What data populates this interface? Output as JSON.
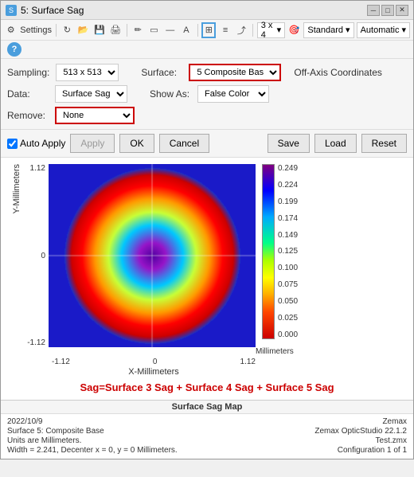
{
  "window": {
    "title": "5: Surface Sag",
    "title_icon": "S"
  },
  "title_buttons": {
    "minimize": "─",
    "maximize": "□",
    "close": "✕"
  },
  "toolbar": {
    "settings_label": "Settings",
    "dropdown1": "3 x 4",
    "dropdown2": "Standard",
    "dropdown3": "Automatic"
  },
  "settings": {
    "sampling_label": "Sampling:",
    "sampling_value": "513 x 513",
    "surface_label": "Surface:",
    "surface_value": "5 Composite Bas",
    "off_axis_label": "Off-Axis Coordinates",
    "data_label": "Data:",
    "data_value": "Surface Sag",
    "show_as_label": "Show As:",
    "show_as_value": "False Color",
    "remove_label": "Remove:",
    "remove_value": "None"
  },
  "buttons": {
    "auto_apply_label": "Auto Apply",
    "apply_label": "Apply",
    "ok_label": "OK",
    "cancel_label": "Cancel",
    "save_label": "Save",
    "load_label": "Load",
    "reset_label": "Reset"
  },
  "chart": {
    "y_axis_label": "Y-Millimeters",
    "x_axis_label": "X-Millimeters",
    "y_ticks": [
      "1.12",
      "0",
      "-1.12"
    ],
    "x_ticks": [
      "-1.12",
      "0",
      "1.12"
    ],
    "colorbar_unit": "Millimeters",
    "colorbar_ticks": [
      "0.249",
      "0.224",
      "0.199",
      "0.174",
      "0.149",
      "0.125",
      "0.100",
      "0.075",
      "0.050",
      "0.025",
      "0.000"
    ]
  },
  "formula": {
    "text": "Sag=Surface 3 Sag + Surface 4 Sag + Surface 5 Sag"
  },
  "footer": {
    "title": "Surface Sag Map",
    "date": "2022/10/9",
    "surface": "Surface 5: Composite Base",
    "units": "Units are Millimeters.",
    "width": "Width = 2.241, Decenter x = 0, y = 0 Millimeters.",
    "software": "Zemax",
    "version": "Zemax OpticStudio 22.1.2",
    "file": "Test.zmx",
    "config": "Configuration 1 of 1"
  }
}
